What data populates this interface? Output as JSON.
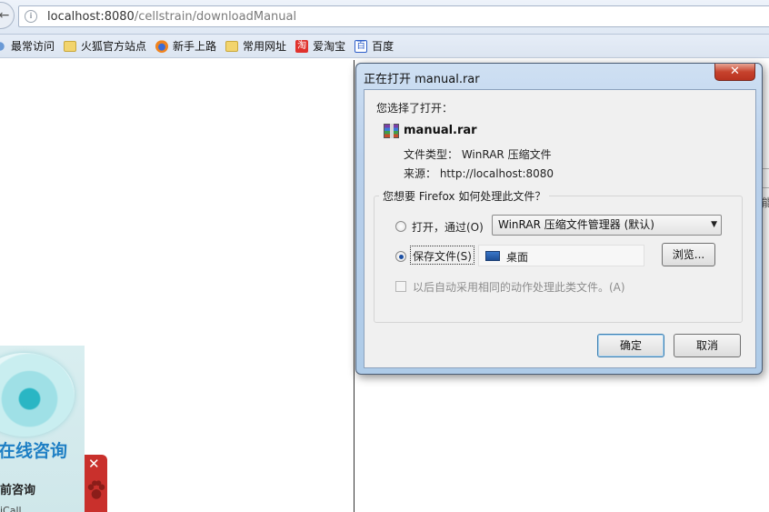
{
  "browser": {
    "url_host": "localhost:8080",
    "url_path": "/cellstrain/downloadManual",
    "back_icon": "back-arrow-icon",
    "bookmarks": [
      {
        "label": "最常访问",
        "icon": "star-icon"
      },
      {
        "label": "火狐官方站点",
        "icon": "folder-icon"
      },
      {
        "label": "新手上路",
        "icon": "firefox-icon"
      },
      {
        "label": "常用网址",
        "icon": "folder-icon"
      },
      {
        "label": "爱淘宝",
        "icon": "taobao-icon",
        "glyph": "淘"
      },
      {
        "label": "百度",
        "icon": "baidu-icon",
        "glyph": "百"
      }
    ]
  },
  "page": {
    "consult_title": "在线咨询",
    "consult_sub": "前咨询",
    "consult_item": "iCall",
    "close_glyph": "✕",
    "right_fragment": "能"
  },
  "dialog": {
    "title": "正在打开 manual.rar",
    "close_glyph": "✕",
    "chosen_label": "您选择了打开：",
    "file_name": "manual.rar",
    "file_type": "文件类型： WinRAR 压缩文件",
    "file_source": "来源： http://localhost:8080",
    "question": "您想要 Firefox 如何处理此文件？",
    "open_with_label": "打开，通过(O)",
    "open_with_value": "WinRAR 压缩文件管理器 (默认)",
    "save_label": "保存文件(S)",
    "save_folder": "桌面",
    "browse_label": "浏览...",
    "auto_label": "以后自动采用相同的动作处理此类文件。(A)",
    "ok_label": "确定",
    "cancel_label": "取消",
    "selected_option": "save",
    "remember_checked": false
  }
}
